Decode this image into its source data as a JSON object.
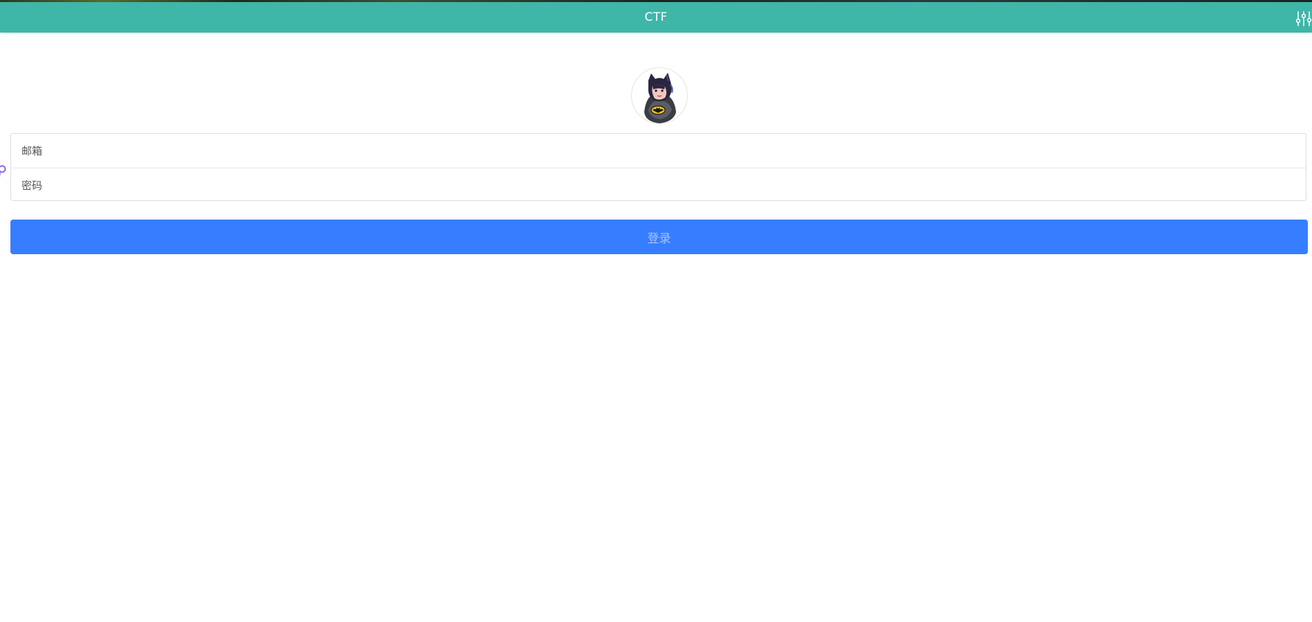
{
  "header": {
    "title": "CTF",
    "settings_icon": "sliders-icon",
    "background_color": "#3eb6a8"
  },
  "avatar": {
    "icon": "batman-avatar"
  },
  "form": {
    "email_placeholder": "邮箱",
    "password_placeholder": "密码",
    "login_label": "登录",
    "button_color": "#377dff"
  }
}
